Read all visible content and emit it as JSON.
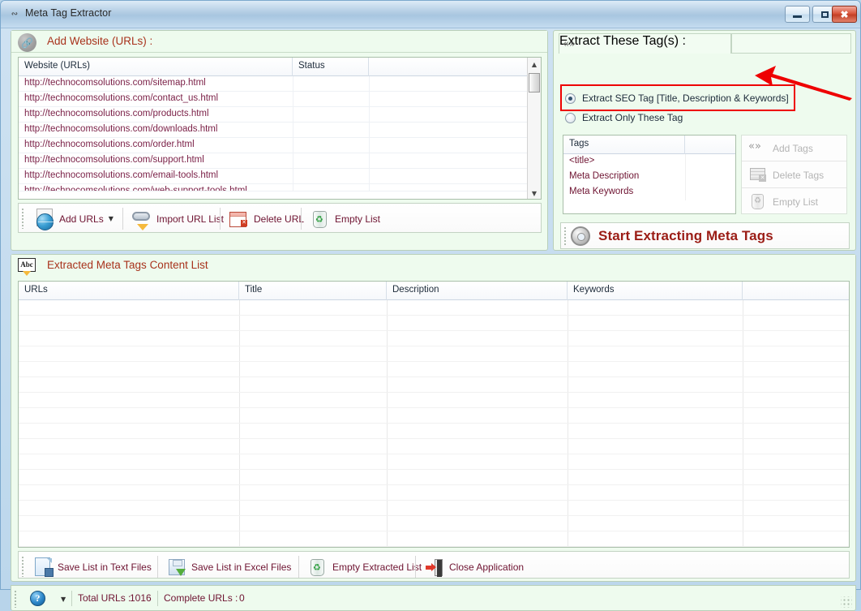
{
  "window": {
    "title": "Meta Tag Extractor",
    "title_icon": "code-icon",
    "minimize_label": "Minimize",
    "maximize_label": "Maximize",
    "close_label": "Close"
  },
  "add_website_panel": {
    "icon": "link-icon",
    "title": "Add Website (URLs) :",
    "grid": {
      "columns": [
        "Website (URLs)",
        "Status",
        ""
      ],
      "rows": [
        "http://technocomsolutions.com/sitemap.html",
        "http://technocomsolutions.com/contact_us.html",
        "http://technocomsolutions.com/products.html",
        "http://technocomsolutions.com/downloads.html",
        "http://technocomsolutions.com/order.html",
        "http://technocomsolutions.com/support.html",
        "http://technocomsolutions.com/email-tools.html",
        "http://technocomsolutions.com/web-support-tools.html"
      ]
    },
    "toolbar": [
      {
        "label": "Add URLs",
        "icon": "globe-add-icon",
        "has_caret": true
      },
      {
        "label": "Import URL List",
        "icon": "import-chain-icon",
        "has_caret": false
      },
      {
        "label": "Delete URL",
        "icon": "table-delete-icon",
        "has_caret": false
      },
      {
        "label": "Empty List",
        "icon": "recycle-bin-icon",
        "has_caret": false
      }
    ]
  },
  "extract_panel": {
    "icon": "angle-brackets-icon",
    "title": "Extract These Tag(s) :",
    "options": [
      {
        "label": "Extract SEO Tag [Title, Description & Keywords]",
        "selected": true
      },
      {
        "label": "Extract Only These Tag",
        "selected": false
      }
    ],
    "highlight_color": "#ee0000",
    "annotation": "red-arrow-pointing-to-seo-option",
    "tags_grid": {
      "columns": [
        "Tags",
        ""
      ],
      "rows": [
        "<title>",
        "Meta Description",
        "Meta Keywords"
      ]
    },
    "tag_buttons": [
      {
        "label": "Add Tags",
        "icon": "angle-brackets-icon",
        "enabled": false
      },
      {
        "label": "Delete Tags",
        "icon": "tag-delete-icon",
        "enabled": false
      },
      {
        "label": "Empty List",
        "icon": "recycle-bin-grey-icon",
        "enabled": false
      }
    ],
    "start_button": {
      "label": "Start Extracting Meta Tags",
      "icon": "gear-icon"
    }
  },
  "extracted_panel": {
    "icon": "abc-icon",
    "title": "Extracted Meta Tags Content List",
    "columns": [
      "URLs",
      "Title",
      "Description",
      "Keywords",
      ""
    ],
    "rows": [],
    "toolbar": [
      {
        "label": "Save List in Text Files",
        "icon": "text-file-icon"
      },
      {
        "label": "Save List in Excel Files",
        "icon": "excel-save-icon"
      },
      {
        "label": "Empty Extracted List",
        "icon": "recycle-bin-icon"
      },
      {
        "label": "Close Application",
        "icon": "exit-door-icon"
      }
    ]
  },
  "statusbar": {
    "help_icon": "help-icon",
    "total_urls_label": "Total URLs :",
    "total_urls_value": "1016",
    "complete_urls_label": "Complete URLs :",
    "complete_urls_value": "0"
  }
}
